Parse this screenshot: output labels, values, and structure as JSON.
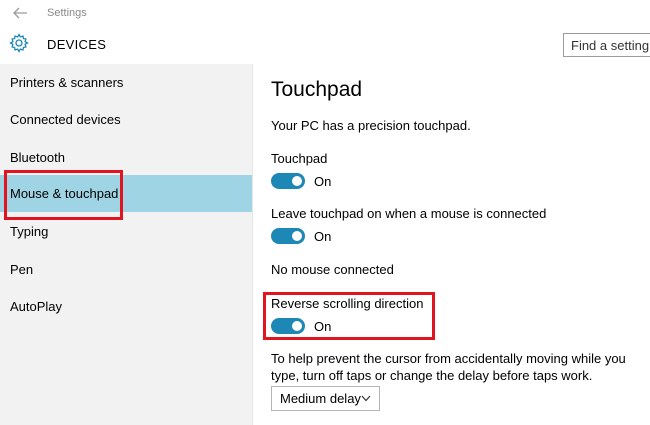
{
  "window": {
    "title": "Settings"
  },
  "header": {
    "title": "DEVICES",
    "search_placeholder": "Find a setting"
  },
  "sidebar": {
    "items": [
      {
        "label": "Printers & scanners"
      },
      {
        "label": "Connected devices"
      },
      {
        "label": "Bluetooth"
      },
      {
        "label": "Mouse & touchpad",
        "selected": true
      },
      {
        "label": "Typing"
      },
      {
        "label": "Pen"
      },
      {
        "label": "AutoPlay"
      }
    ]
  },
  "content": {
    "title": "Touchpad",
    "precision_note": "Your PC has a precision touchpad.",
    "touchpad": {
      "label": "Touchpad",
      "state": "On"
    },
    "leave_on": {
      "label": "Leave touchpad on when a mouse is connected",
      "state": "On"
    },
    "mouse_status": "No mouse connected",
    "reverse_scrolling": {
      "label": "Reverse scrolling direction",
      "state": "On"
    },
    "help_text": "To help prevent the cursor from accidentally moving while you type, turn off taps or change the delay before taps work.",
    "delay": {
      "selected": "Medium delay"
    }
  },
  "colors": {
    "accent": "#1d87b5",
    "selected_item_bg": "#9fd4e4",
    "sidebar_bg": "#f2f2f2",
    "highlight_box": "#e2141f"
  },
  "icons": {
    "back": "back-arrow-icon",
    "settings": "gear-icon",
    "dropdown": "chevron-down-icon"
  }
}
